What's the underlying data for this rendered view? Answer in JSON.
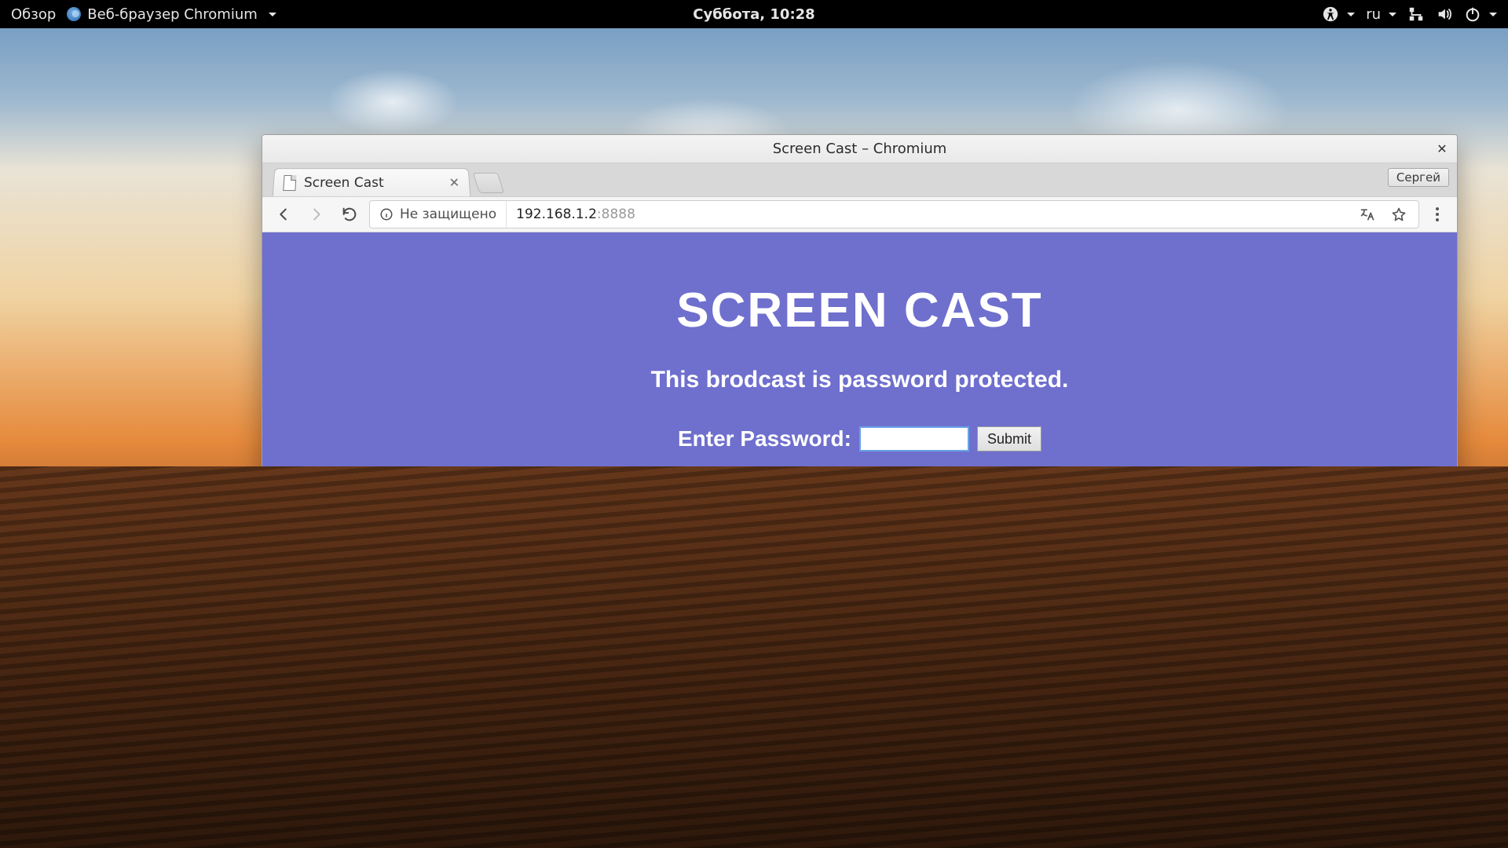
{
  "topbar": {
    "activities": "Обзор",
    "app_name": "Веб-браузер Chromium",
    "clock": "Суббота, 10:28",
    "keyboard_layout": "ru"
  },
  "window": {
    "title": "Screen Cast – Chromium",
    "profile_label": "Сергей"
  },
  "tabs": {
    "active_title": "Screen Cast"
  },
  "addressbar": {
    "security_label": "Не защищено",
    "url_host": "192.168.1.2",
    "url_port": ":8888"
  },
  "page": {
    "heading": "SCREEN CAST",
    "subtitle": "This brodcast is password protected.",
    "password_label": "Enter Password:",
    "submit_label": "Submit"
  }
}
